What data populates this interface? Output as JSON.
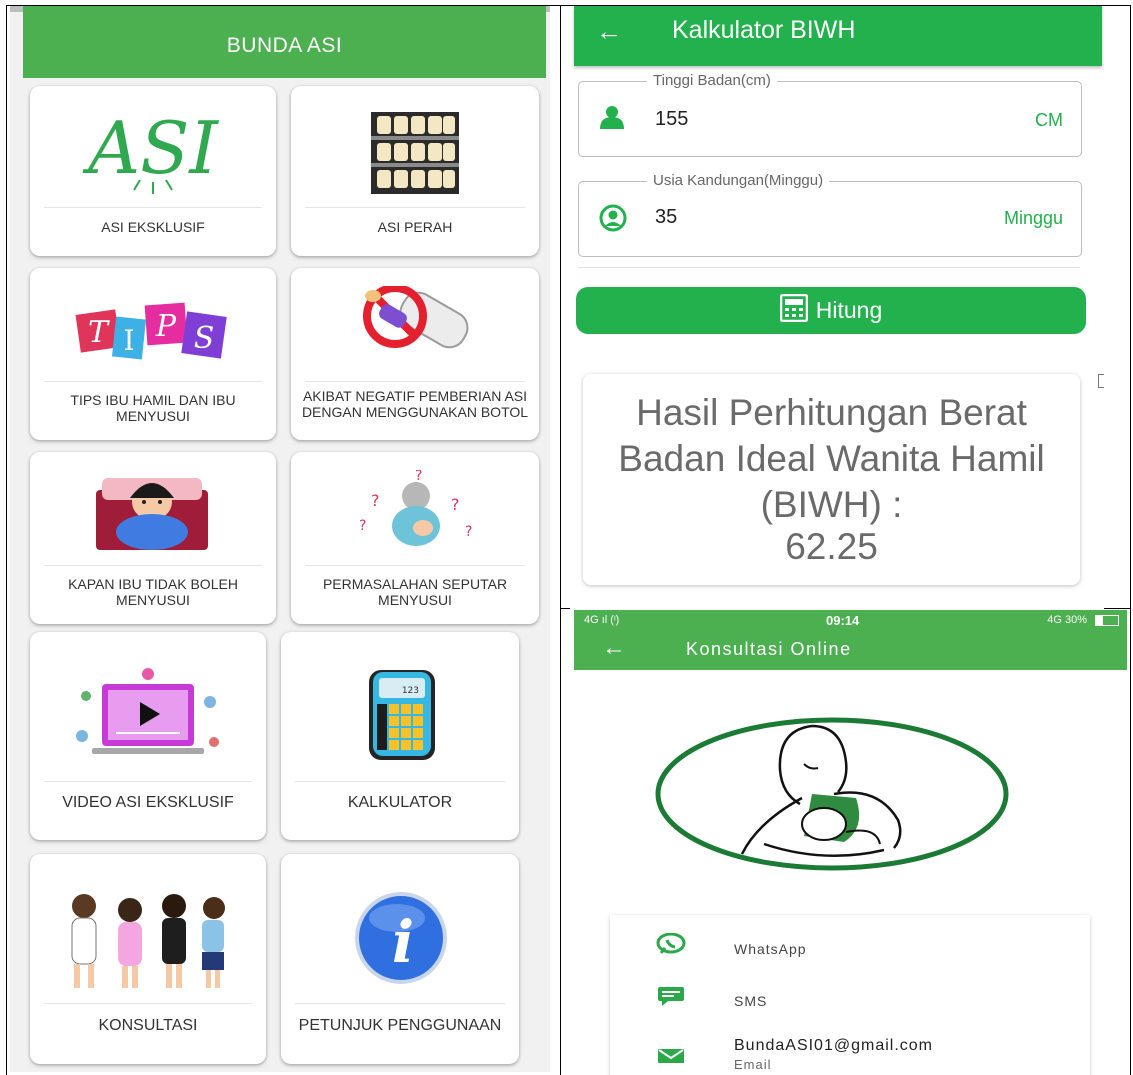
{
  "menu": {
    "app_title": "BUNDA ASI",
    "items": [
      {
        "label": "ASI EKSKLUSIF",
        "logo_text": "ASI"
      },
      {
        "label": "ASI PERAH"
      },
      {
        "label": "TIPS IBU HAMIL DAN IBU MENYUSUI",
        "logo_text": "TIPS"
      },
      {
        "label": "AKIBAT NEGATIF PEMBERIAN ASI DENGAN MENGGUNAKAN BOTOL"
      },
      {
        "label": "KAPAN IBU TIDAK BOLEH MENYUSUI"
      },
      {
        "label": "PERMASALAHAN SEPUTAR MENYUSUI"
      },
      {
        "label": "VIDEO ASI EKSKLUSIF"
      },
      {
        "label": "KALKULATOR",
        "screen_text": "123"
      },
      {
        "label": "KONSULTASI"
      },
      {
        "label": "PETUNJUK PENGGUNAAN",
        "logo_text": "i"
      }
    ]
  },
  "calculator": {
    "back_icon": "arrow-left-icon",
    "title": "Kalkulator BIWH",
    "height_field": {
      "label": "Tinggi Badan(cm)",
      "value": "155",
      "suffix": "CM"
    },
    "age_field": {
      "label": "Usia Kandungan(Minggu)",
      "value": "35",
      "suffix": "Minggu"
    },
    "button_label": "Hitung",
    "result_text": "Hasil Perhitungan Berat Badan Ideal Wanita Hamil (BIWH) :",
    "result_value": "62.25",
    "accent_color": "#22b14c"
  },
  "consultation": {
    "status_left": "4G ıl (ᶦ)",
    "status_time": "09:14",
    "status_right": "4G 30%",
    "title": "Konsultasi Online",
    "contacts": [
      {
        "label": "WhatsApp",
        "icon": "whatsapp-icon"
      },
      {
        "label": "SMS",
        "icon": "sms-icon"
      },
      {
        "label": "BundaASI01@gmail.com",
        "sub": "Email",
        "icon": "email-icon"
      }
    ]
  }
}
